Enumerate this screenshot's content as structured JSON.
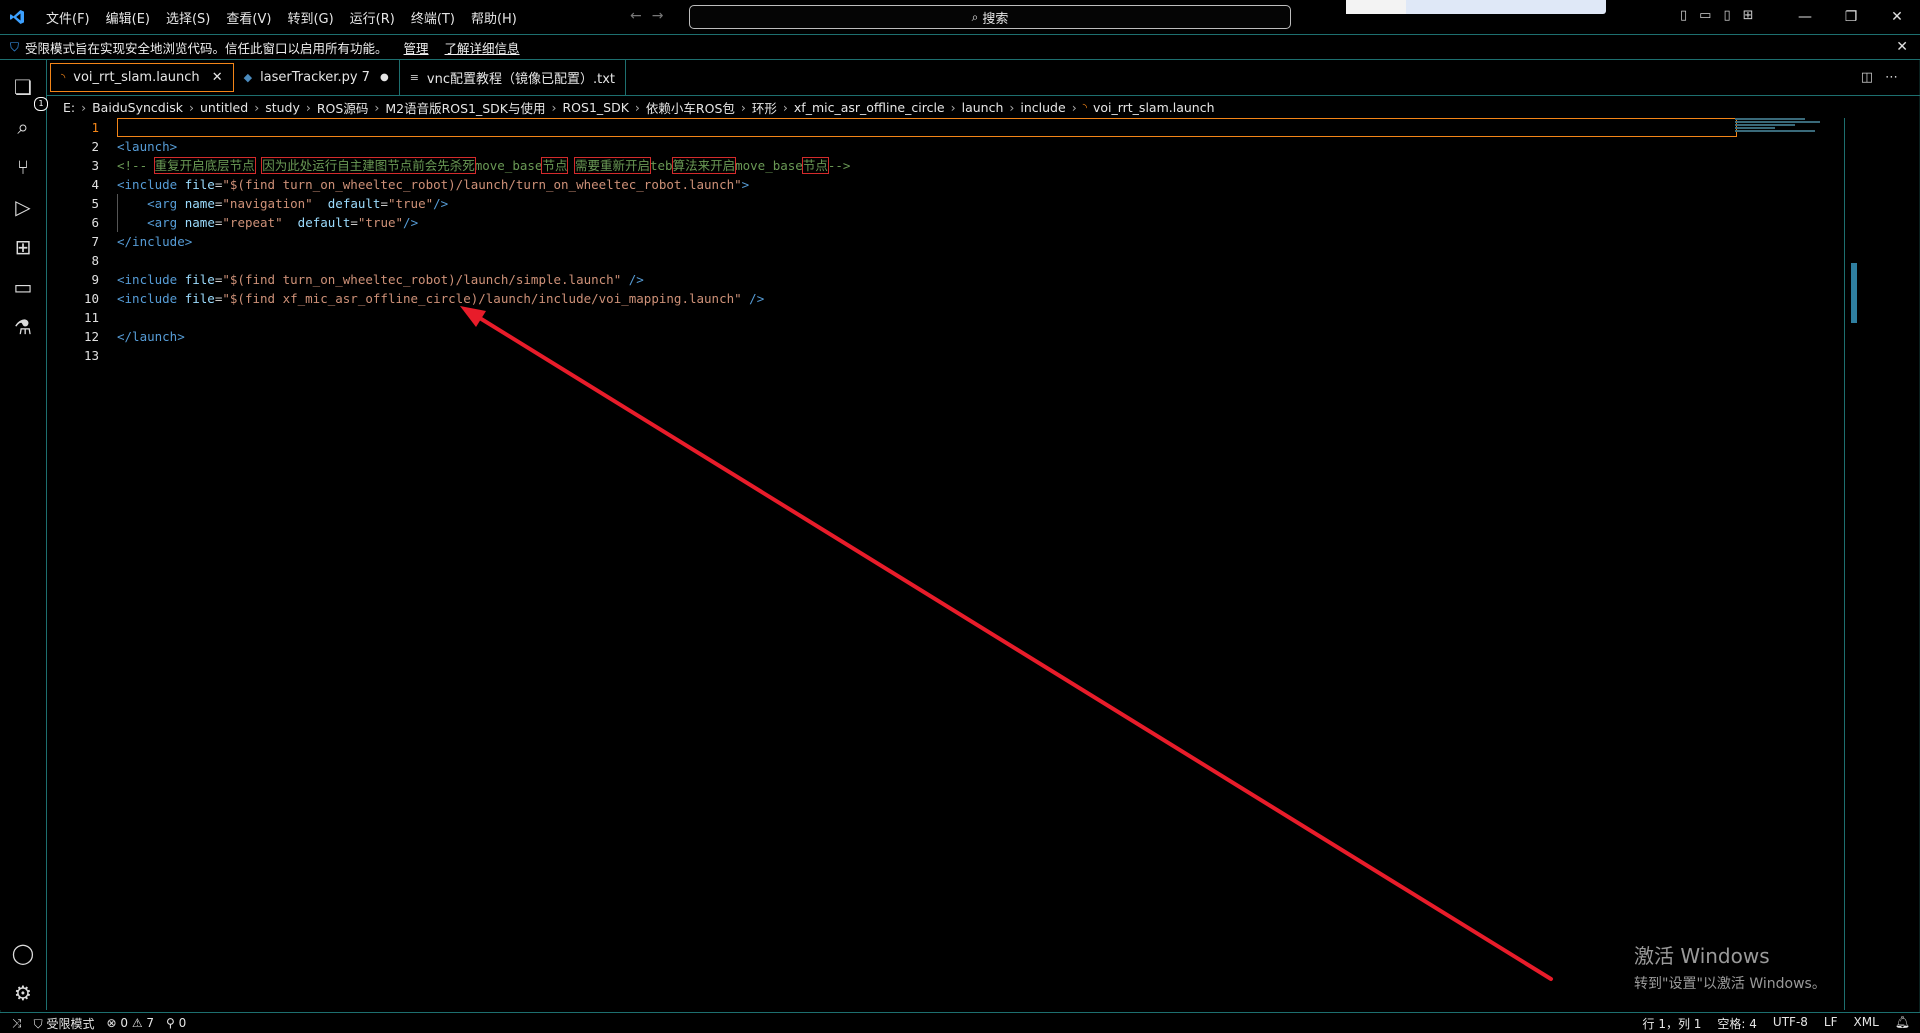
{
  "titlebar": {
    "menu": [
      "文件(F)",
      "编辑(E)",
      "选择(S)",
      "查看(V)",
      "转到(G)",
      "运行(R)",
      "终端(T)",
      "帮助(H)"
    ],
    "search_label": "搜索"
  },
  "banner": {
    "message": "受限模式旨在实现安全地浏览代码。信任此窗口以启用所有功能。",
    "manage": "管理",
    "learn_more": "了解详细信息"
  },
  "activity": {
    "explorer_badge": "1"
  },
  "tabs": [
    {
      "label": "voi_rrt_slam.launch",
      "active": true
    },
    {
      "label": "laserTracker.py 7",
      "modified": true
    },
    {
      "label": "vnc配置教程（镜像已配置）.txt"
    }
  ],
  "breadcrumb": [
    "E:",
    "BaiduSyncdisk",
    "untitled",
    "study",
    "ROS源码",
    "M2语音版ROS1_SDK与使用",
    "ROS1_SDK",
    "依赖小车ROS包",
    "环形",
    "xf_mic_asr_offline_circle",
    "launch",
    "include",
    "voi_rrt_slam.launch"
  ],
  "editor": {
    "line_numbers": [
      "1",
      "2",
      "3",
      "4",
      "5",
      "6",
      "7",
      "8",
      "9",
      "10",
      "11",
      "12",
      "13"
    ],
    "lines": {
      "l2": "<launch>",
      "l3_open": "<!-- ",
      "l3_a": "重复开启底层节点",
      "l3_b": "因为此处运行自主建图节点前会先杀死",
      "l3_c": "move_base",
      "l3_d": "节点",
      "l3_e": "需要重新开启",
      "l3_f": "teb",
      "l3_g": "算法来开启",
      "l3_h": "move_base",
      "l3_i": "节点",
      "l3_close": "-->",
      "l4_tag": "<include ",
      "l4_attr": "file",
      "l4_eq": "=",
      "l4_val": "\"$(find turn_on_wheeltec_robot)/launch/turn_on_wheeltec_robot.launch\"",
      "l4_end": ">",
      "l5_tag": "<arg ",
      "l5_attr1": "name",
      "l5_val1": "\"navigation\"",
      "l5_attr2": "default",
      "l5_val2": "\"true\"",
      "l5_end": "/>",
      "l6_tag": "<arg ",
      "l6_attr1": "name",
      "l6_val1": "\"repeat\"",
      "l6_attr2": "default",
      "l6_val2": "\"true\"",
      "l6_end": "/>",
      "l7": "</include>",
      "l9_tag": "<include ",
      "l9_attr": "file",
      "l9_val": "\"$(find turn_on_wheeltec_robot)/launch/simple.launch\"",
      "l9_end": " />",
      "l10_tag": "<include ",
      "l10_attr": "file",
      "l10_val": "\"$(find xf_mic_asr_offline_circle)/launch/include/voi_mapping.launch\"",
      "l10_end": " />",
      "l12": "</launch>"
    }
  },
  "annotation_color": "#e81c2a",
  "watermark": {
    "title": "激活 Windows",
    "subtitle": "转到\"设置\"以激活 Windows。"
  },
  "statusbar": {
    "restricted": "受限模式",
    "errors": "0",
    "warnings": "7",
    "ports": "0",
    "position": "行 1，列 1",
    "spaces": "空格: 4",
    "encoding": "UTF-8",
    "eol": "LF",
    "language": "XML"
  }
}
